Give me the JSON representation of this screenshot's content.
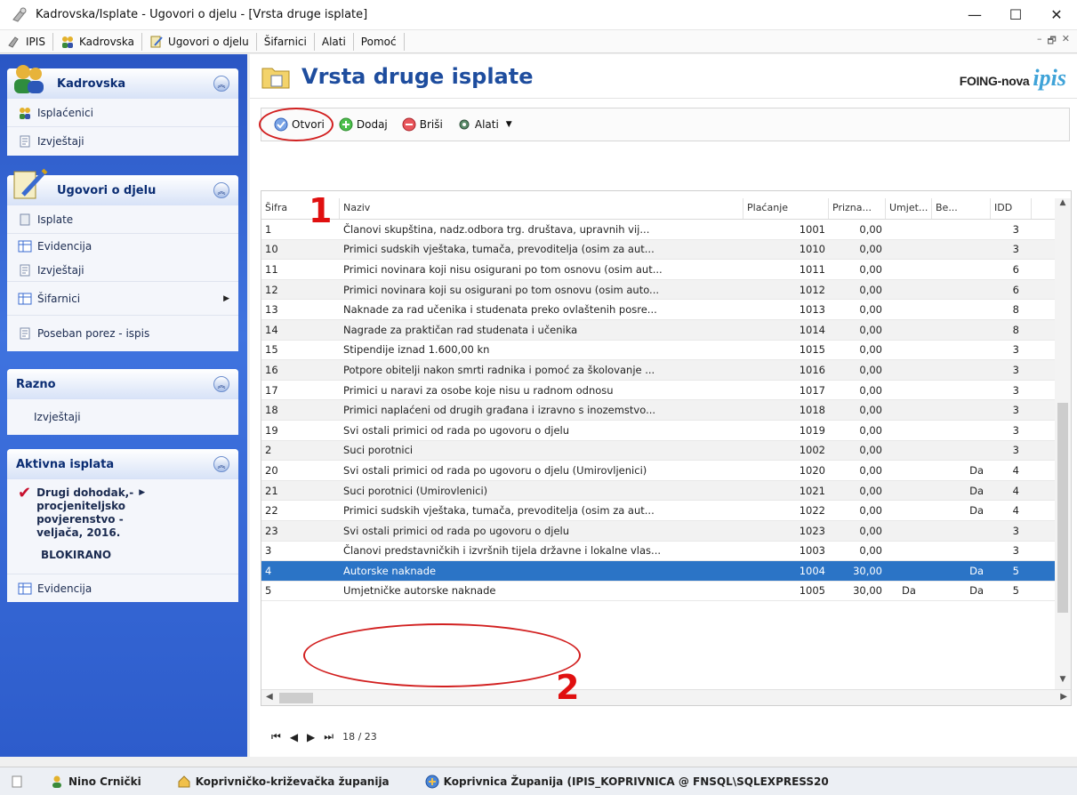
{
  "window": {
    "title": "Kadrovska/Isplate - Ugovori o djelu - [Vrsta druge isplate]",
    "minimize": "—",
    "maximize": "☐",
    "close": "✕"
  },
  "menu": [
    "IPIS",
    "Kadrovska",
    "Ugovori o djelu",
    "Šifarnici",
    "Alati",
    "Pomoć"
  ],
  "mdi_buttons": [
    "–",
    "🗗",
    "✕"
  ],
  "sidebar": {
    "kadrovska": {
      "title": "Kadrovska",
      "items": [
        "Isplaćenici",
        "Izvještaji"
      ]
    },
    "ugovori": {
      "title": "Ugovori o djelu",
      "items": [
        "Isplate",
        "Evidencija",
        "Izvještaji",
        "Šifarnici",
        "Poseban porez - ispis"
      ]
    },
    "razno": {
      "title": "Razno",
      "items": [
        "Izvještaji"
      ]
    },
    "aktivna": {
      "title": "Aktivna isplata",
      "active_line1": "Drugi dohodak,-",
      "active_line2": "procjeniteljsko",
      "active_line3": "povjerenstvo -",
      "active_line4": "veljača, 2016.",
      "status": "BLOKIRANO",
      "item": "Evidencija"
    }
  },
  "header": {
    "title": "Vrsta druge isplate",
    "brand_prefix": "FOING-nova",
    "brand_logo": "ipis"
  },
  "toolbar": {
    "open": "Otvori",
    "add": "Dodaj",
    "delete": "Briši",
    "tools": "Alati"
  },
  "grid": {
    "columns": [
      "Šifra",
      "Naziv",
      "Plaćanje",
      "Prizna...",
      "Umjet...",
      "Be...",
      "IDD"
    ],
    "rows": [
      [
        "1",
        "Članovi skupština, nadz.odbora trg. društava, upravnih vij...",
        "1001",
        "0,00",
        "",
        "",
        "3"
      ],
      [
        "10",
        "Primici sudskih vještaka, tumača, prevoditelja (osim za aut...",
        "1010",
        "0,00",
        "",
        "",
        "3"
      ],
      [
        "11",
        "Primici novinara koji nisu osigurani po tom osnovu (osim aut...",
        "1011",
        "0,00",
        "",
        "",
        "6"
      ],
      [
        "12",
        "Primici novinara koji su osigurani po tom osnovu (osim auto...",
        "1012",
        "0,00",
        "",
        "",
        "6"
      ],
      [
        "13",
        "Naknade za rad učenika i studenata preko ovlaštenih posre...",
        "1013",
        "0,00",
        "",
        "",
        "8"
      ],
      [
        "14",
        "Nagrade za praktičan rad studenata i učenika",
        "1014",
        "0,00",
        "",
        "",
        "8"
      ],
      [
        "15",
        "Stipendije iznad 1.600,00 kn",
        "1015",
        "0,00",
        "",
        "",
        "3"
      ],
      [
        "16",
        "Potpore obitelji nakon smrti radnika i pomoć za školovanje ...",
        "1016",
        "0,00",
        "",
        "",
        "3"
      ],
      [
        "17",
        "Primici u naravi za osobe koje nisu u radnom odnosu",
        "1017",
        "0,00",
        "",
        "",
        "3"
      ],
      [
        "18",
        "Primici naplaćeni od drugih građana i izravno s inozemstvo...",
        "1018",
        "0,00",
        "",
        "",
        "3"
      ],
      [
        "19",
        "Svi ostali primici od rada po ugovoru o djelu",
        "1019",
        "0,00",
        "",
        "",
        "3"
      ],
      [
        "2",
        "Suci porotnici",
        "1002",
        "0,00",
        "",
        "",
        "3"
      ],
      [
        "20",
        "Svi ostali primici od rada po ugovoru o djelu (Umirovljenici)",
        "1020",
        "0,00",
        "",
        "Da",
        "4"
      ],
      [
        "21",
        "Suci porotnici (Umirovlenici)",
        "1021",
        "0,00",
        "",
        "Da",
        "4"
      ],
      [
        "22",
        "Primici sudskih vještaka, tumača, prevoditelja (osim za aut...",
        "1022",
        "0,00",
        "",
        "Da",
        "4"
      ],
      [
        "23",
        "Svi ostali primici od rada po ugovoru o djelu",
        "1023",
        "0,00",
        "",
        "",
        "3"
      ],
      [
        "3",
        "Članovi predstavničkih i izvršnih tijela državne i lokalne vlas...",
        "1003",
        "0,00",
        "",
        "",
        "3"
      ],
      [
        "4",
        "Autorske naknade",
        "1004",
        "30,00",
        "",
        "Da",
        "5"
      ],
      [
        "5",
        "Umjetničke autorske naknade",
        "1005",
        "30,00",
        "Da",
        "Da",
        "5"
      ]
    ],
    "selected_index": 17
  },
  "annotations": {
    "one": "1",
    "two": "2"
  },
  "pager": {
    "first": "⏮",
    "prev": "◀",
    "next": "▶",
    "last": "⏭",
    "position": "18 / 23"
  },
  "statusbar": {
    "user": "Nino Crnički",
    "county": "Koprivničko-križevačka županija",
    "connection": "Koprivnica Županija (IPIS_KOPRIVNICA @ FNSQL\\SQLEXPRESS20"
  },
  "colors": {
    "sidebar": "#2d5ccb",
    "selected_row": "#2b74c6",
    "title": "#1e4d9e",
    "annotation": "#d22020"
  }
}
